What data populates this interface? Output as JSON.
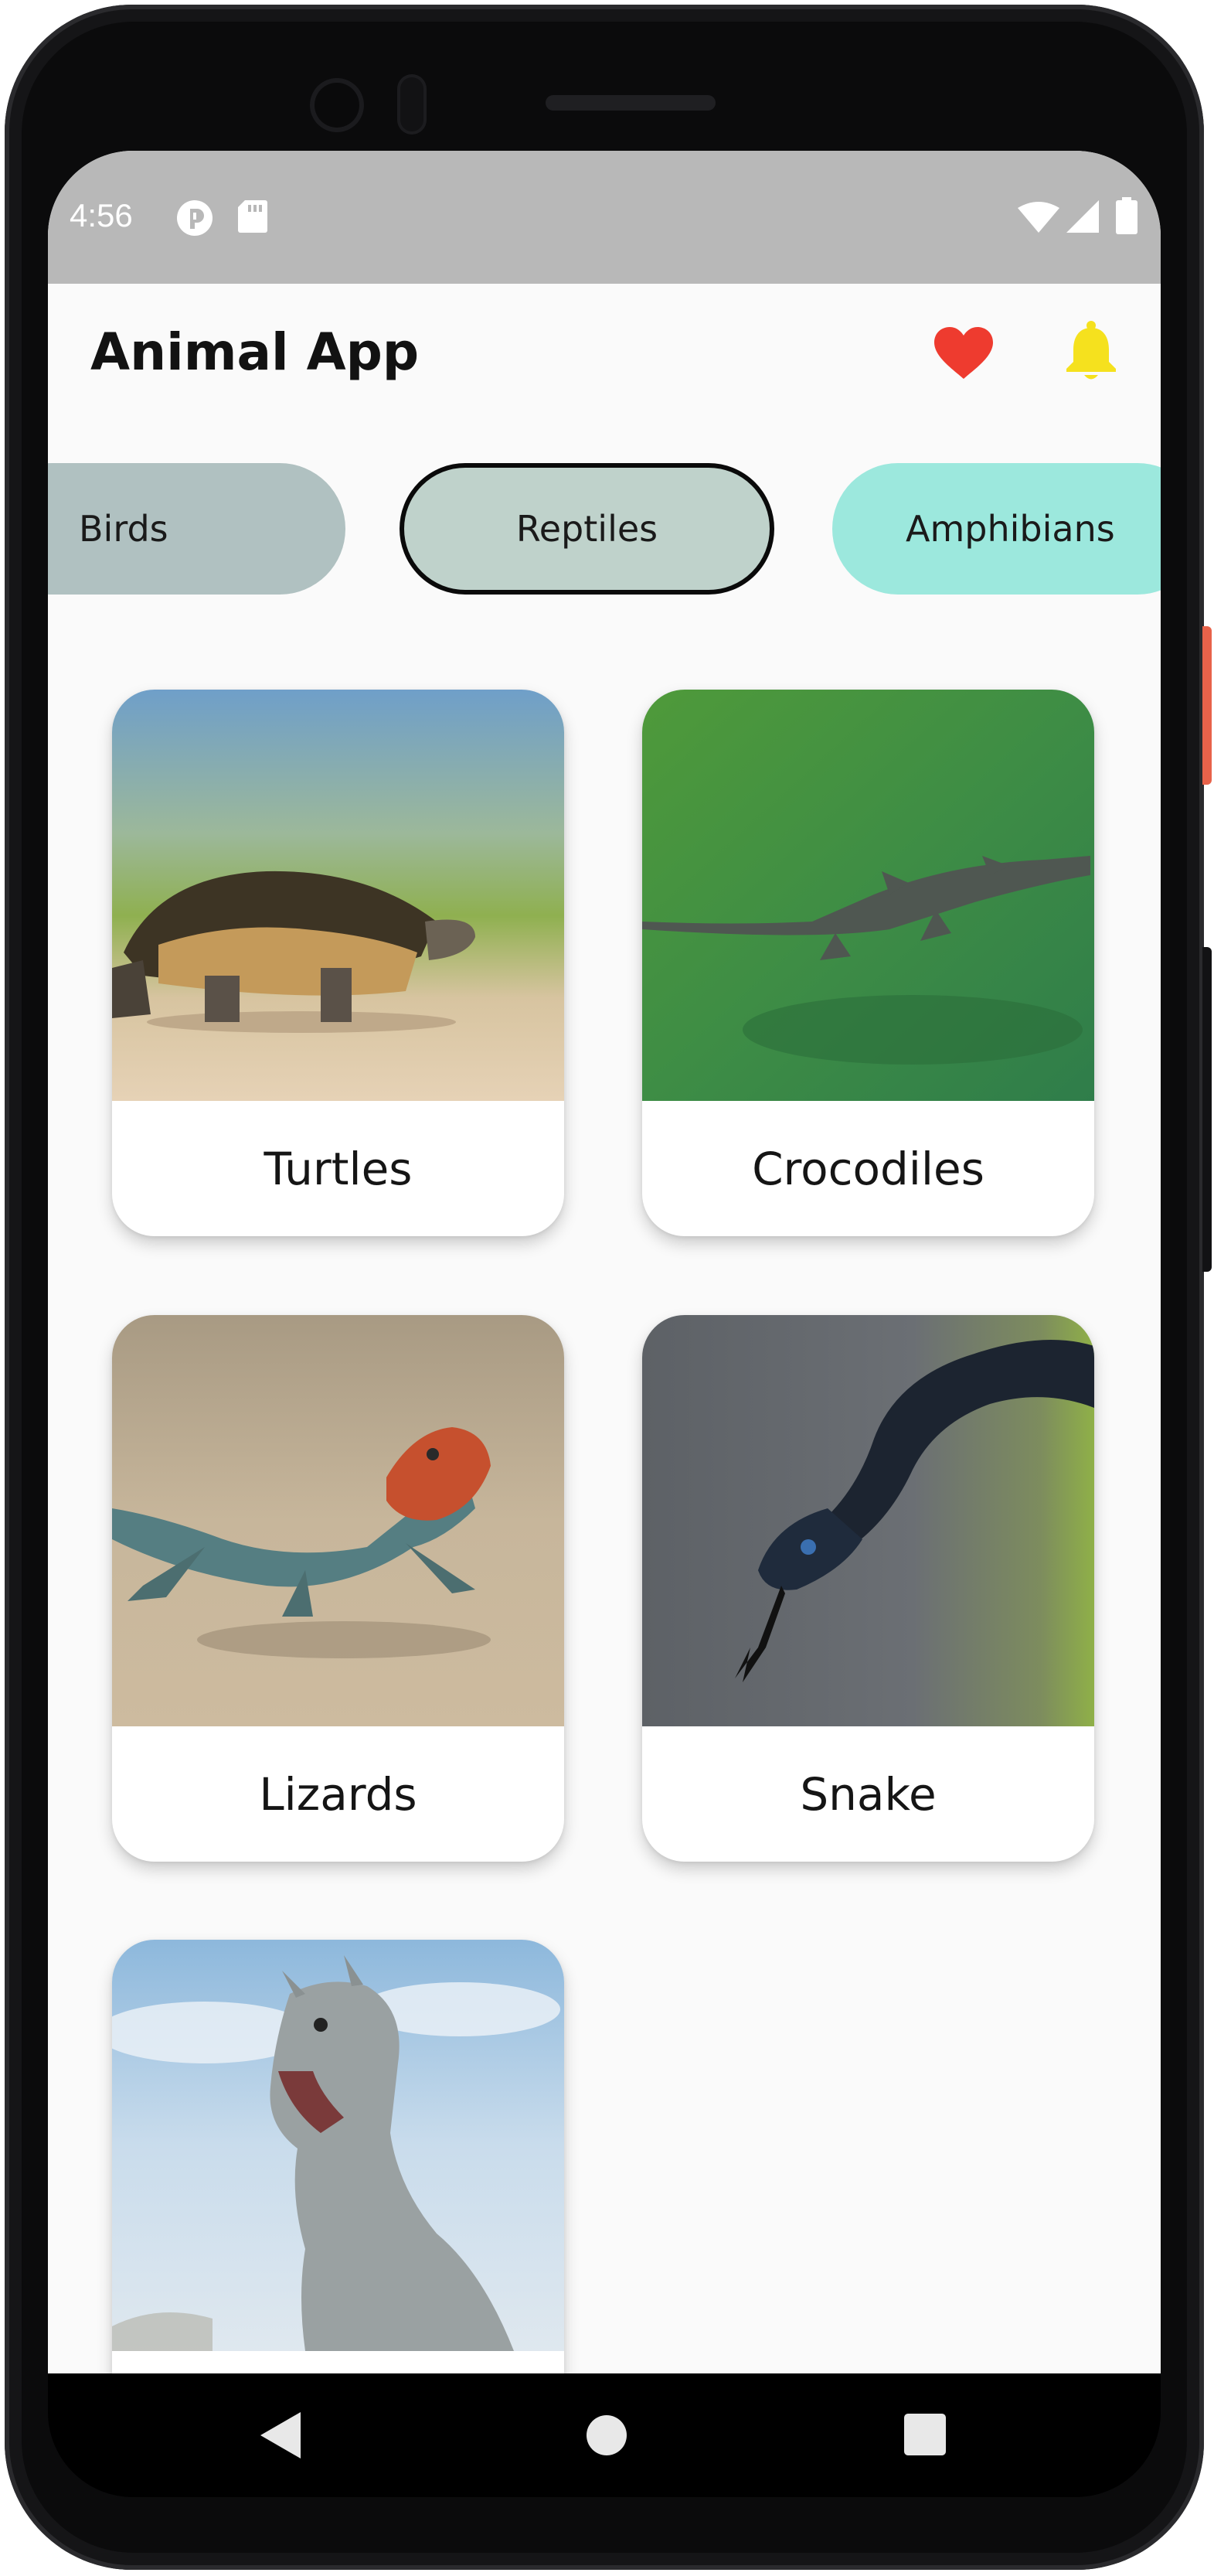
{
  "status_bar": {
    "time": "4:56"
  },
  "app": {
    "title": "Animal App"
  },
  "header_icons": [
    {
      "name": "heart-icon",
      "color": "#ee3b2f"
    },
    {
      "name": "bell-icon",
      "color": "#f5e11e"
    }
  ],
  "categories": [
    {
      "label": "Birds",
      "color": "#b0c1c1",
      "selected": false
    },
    {
      "label": "Reptiles",
      "color": "#bfd2cb",
      "selected": true
    },
    {
      "label": "Amphibians",
      "color": "#9ce8dd",
      "selected": false
    }
  ],
  "animals": [
    {
      "label": "Turtles"
    },
    {
      "label": "Crocodiles"
    },
    {
      "label": "Lizards"
    },
    {
      "label": "Snake"
    },
    {
      "label": ""
    }
  ],
  "nav": [
    {
      "name": "back-icon"
    },
    {
      "name": "home-icon"
    },
    {
      "name": "recents-icon"
    }
  ]
}
